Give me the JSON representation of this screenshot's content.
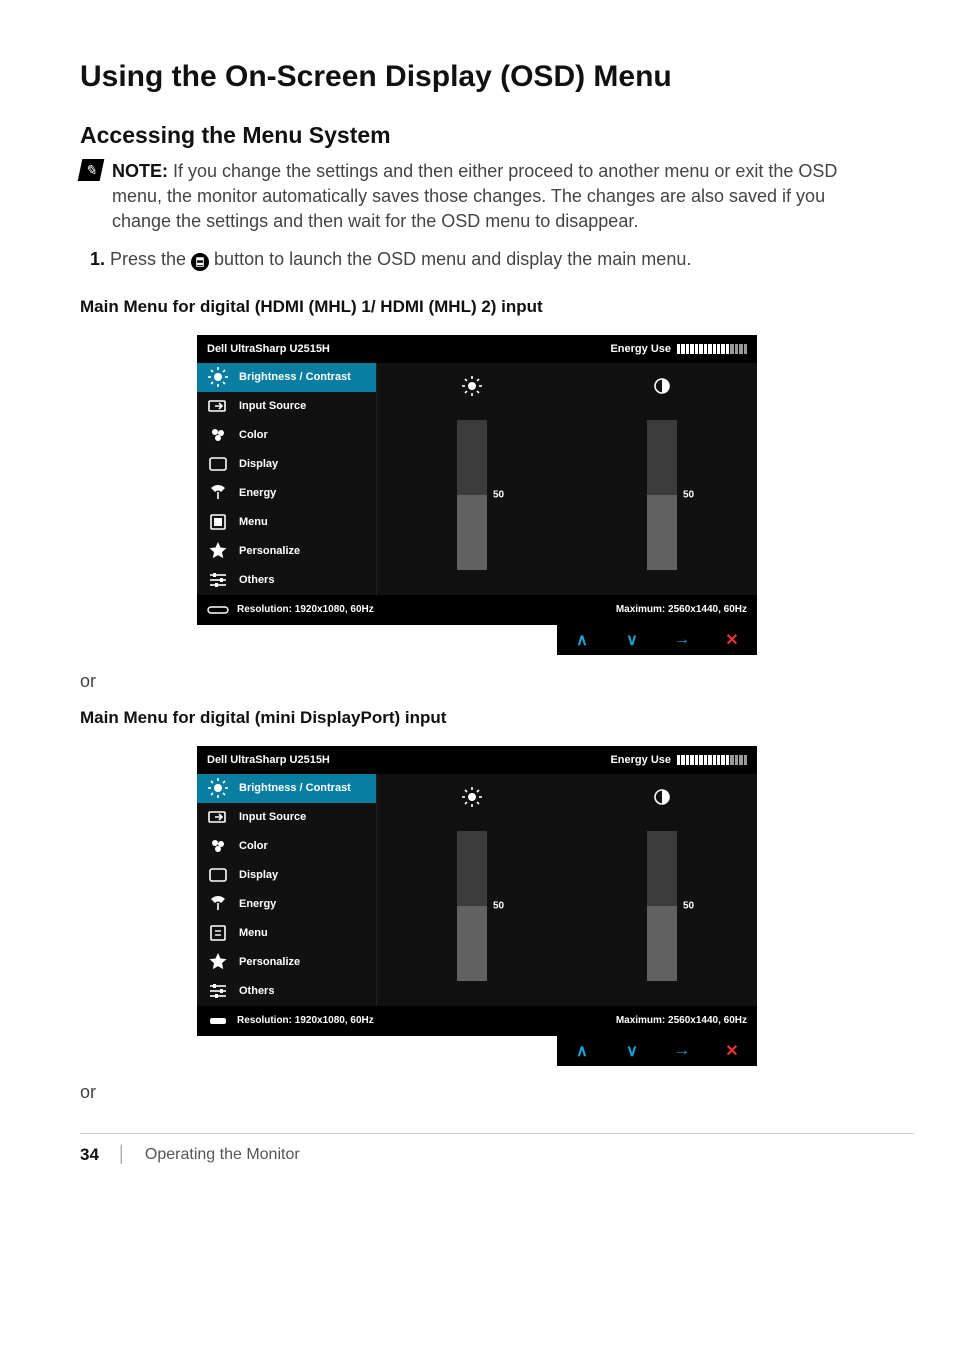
{
  "page": {
    "title": "Using the On-Screen Display (OSD) Menu",
    "subtitle": "Accessing the Menu System",
    "note_label": "NOTE:",
    "note_body": " If you change the settings and then either proceed to another menu or exit the OSD menu, the monitor automatically saves those changes. The changes are also saved if you change the settings and then wait for the OSD menu to disappear.",
    "step1_pre": "Press the ",
    "step1_post": " button to launch the OSD menu and display the main menu.",
    "section_hdmi": "Main Menu for digital (HDMI (MHL) 1/ HDMI (MHL) 2) input",
    "section_mdp": "Main Menu for digital (mini DisplayPort) input",
    "or": "or",
    "page_number": "34",
    "footer_divider": "│",
    "footer_text": "Operating the Monitor"
  },
  "osd": {
    "title": "Dell UltraSharp U2515H",
    "energy_label": "Energy Use",
    "menu_items": [
      {
        "id": "brightness",
        "label": "Brightness / Contrast"
      },
      {
        "id": "input",
        "label": "Input Source"
      },
      {
        "id": "color",
        "label": "Color"
      },
      {
        "id": "display",
        "label": "Display"
      },
      {
        "id": "energy",
        "label": "Energy"
      },
      {
        "id": "menu",
        "label": "Menu"
      },
      {
        "id": "personalize",
        "label": "Personalize"
      },
      {
        "id": "others",
        "label": "Others"
      }
    ],
    "brightness_value": "50",
    "contrast_value": "50",
    "resolution": "Resolution: 1920x1080, 60Hz",
    "maximum": "Maximum: 2560x1440, 60Hz"
  }
}
